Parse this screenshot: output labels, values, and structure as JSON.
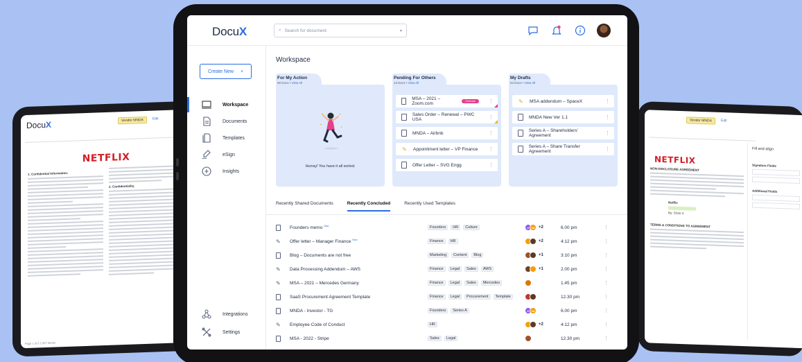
{
  "app": {
    "logo_text": "Docu",
    "logo_accent": "X",
    "brand_color": "#2b6de0"
  },
  "search": {
    "placeholder": "Search for document"
  },
  "topbar_icons": [
    "chat-icon",
    "bell-icon",
    "info-icon",
    "user-avatar"
  ],
  "sidebar": {
    "create_label": "Create New",
    "items": [
      {
        "label": "Workspace",
        "icon": "workspace-icon",
        "active": true
      },
      {
        "label": "Documents",
        "icon": "document-icon",
        "active": false
      },
      {
        "label": "Templates",
        "icon": "templates-icon",
        "active": false
      },
      {
        "label": "eSign",
        "icon": "esign-icon",
        "active": false
      },
      {
        "label": "Insights",
        "icon": "insights-icon",
        "active": false
      }
    ],
    "bottom_items": [
      {
        "label": "Integrations",
        "icon": "integrations-icon"
      },
      {
        "label": "Settings",
        "icon": "settings-icon"
      }
    ]
  },
  "workspace": {
    "title": "Workspace",
    "cards": [
      {
        "title": "For My Action",
        "count": "00 Docs",
        "link": "View All",
        "empty_message": "Hurray! You have it all sorted."
      },
      {
        "title": "Pending For Others",
        "count": "13 Docs",
        "link": "View All",
        "items": [
          {
            "label": "MSA – 2021 – Zoom.com",
            "icon": "doc",
            "badge": "Overdue",
            "corner": "pink"
          },
          {
            "label": "Sales Order – Renewal – PWC USA",
            "icon": "doc",
            "corner": "yellow"
          },
          {
            "label": "MNDA – Airbnb",
            "icon": "doc"
          },
          {
            "label": "Appointment letter – VP Finance",
            "icon": "sign-yellow"
          },
          {
            "label": "Offer Letter – SVG Engg",
            "icon": "doc"
          }
        ]
      },
      {
        "title": "My Drafts",
        "count": "04 Docs",
        "link": "View All",
        "items": [
          {
            "label": "MSA addendum – SpaceX",
            "icon": "sign-yellow"
          },
          {
            "label": "MNDA New Ver 1.1",
            "icon": "doc"
          },
          {
            "label": "Series A – Shareholders' Agreement",
            "icon": "doc"
          },
          {
            "label": "Series A – Share Transfer Agreement",
            "icon": "doc"
          }
        ]
      }
    ]
  },
  "tabs": [
    {
      "label": "Recently Shared Documents",
      "active": false
    },
    {
      "label": "Recently Concluded",
      "active": true
    },
    {
      "label": "Recently Used Templates",
      "active": false
    }
  ],
  "rows": [
    {
      "name": "Founders memo",
      "new": "New",
      "icon": "doc",
      "tags": [
        "Founders",
        "HR",
        "Culture"
      ],
      "extra": "+2",
      "time": "6.00 pm"
    },
    {
      "name": "Offer letter – Manager Finance",
      "new": "New",
      "icon": "sign",
      "tags": [
        "Finance",
        "HR"
      ],
      "extra": "+2",
      "time": "4:12 pm"
    },
    {
      "name": "Blog – Documents are not free",
      "icon": "doc",
      "tags": [
        "Marketing",
        "Content",
        "Blog"
      ],
      "extra": "+1",
      "time": "3:10 pm"
    },
    {
      "name": "Data Processing Addendum – AWS",
      "icon": "sign",
      "tags": [
        "Finance",
        "Legal",
        "Sales",
        "AWS"
      ],
      "extra": "+1",
      "time": "2.00 pm"
    },
    {
      "name": "MSA – 2021 – Mercedes Germany",
      "icon": "sign",
      "tags": [
        "Finance",
        "Legal",
        "Sales",
        "Mercedes"
      ],
      "extra": "",
      "time": "1.45 pm"
    },
    {
      "name": "SaaS Procurement Agreement Template",
      "icon": "doc",
      "tags": [
        "Finance",
        "Legal",
        "Procurement",
        "Template"
      ],
      "extra": "",
      "time": "12.30 pm"
    },
    {
      "name": "MNDA - Investor - TG",
      "icon": "doc",
      "tags": [
        "Founders",
        "Series A"
      ],
      "extra": "",
      "time": "6.00 pm"
    },
    {
      "name": "Employee Code of Conduct",
      "icon": "sign",
      "tags": [
        "HR"
      ],
      "extra": "+2",
      "time": "4:12 pm"
    },
    {
      "name": "MSA - 2022 - Stripe",
      "icon": "doc",
      "tags": [
        "Sales",
        "Legal"
      ],
      "extra": "",
      "time": "12.30 pm"
    }
  ],
  "avatar_initials": [
    "K",
    "VA"
  ],
  "bg_left": {
    "logo": "Docu",
    "logo_accent": "X",
    "tag": "Vendor MNDA",
    "edit": "Edit",
    "heading": "NETFLIX",
    "section1": "1. Confidential Information.",
    "section2": "2. Confidentiality.",
    "footer": "Page 1 of 5   1,557 Words"
  },
  "bg_right": {
    "tag": "Vendor MNDA",
    "edit": "Edit",
    "heading": "NETFLIX",
    "section1": "NON-DISCLOSURE AGREEMENT",
    "section2": "TERMS & CONDITIONS TO AGREEMENT",
    "panel_title": "Fill and align",
    "panel_items": [
      "Signature Fields",
      "Additional Fields"
    ],
    "company": "Netflix",
    "signatory": "By: Chris V."
  }
}
